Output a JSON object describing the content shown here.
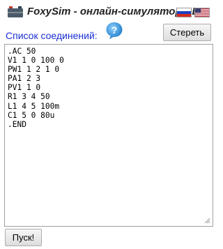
{
  "app": {
    "title": "FoxySim - онлайн-симулятор ЭЦ"
  },
  "icons": {
    "logo": "battery-logo-icon",
    "lang_ru": "russian-flag-icon",
    "lang_en": "us-flag-icon",
    "help": "help-question-icon"
  },
  "colors": {
    "label_blue": "#1a2fd6",
    "help_blue": "#2a8fd6"
  },
  "netlist": {
    "label": "Список соединений:",
    "lines": [
      ".AC 50",
      "V1 1 0 100 0",
      "PW1 1 2 1 0",
      "PA1 2 3",
      "PV1 1 0",
      "R1 3 4 50",
      "L1 4 5 100m",
      "C1 5 0 80u",
      ".END"
    ]
  },
  "buttons": {
    "clear": "Стереть",
    "run": "Пуск!"
  }
}
